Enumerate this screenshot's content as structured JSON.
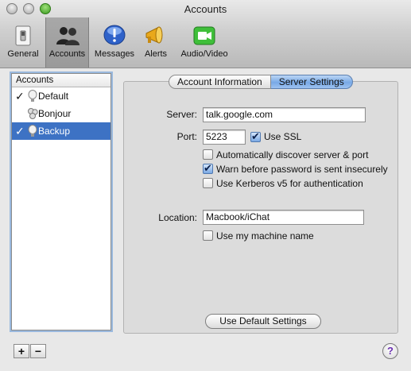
{
  "window": {
    "title": "Accounts"
  },
  "toolbar": {
    "items": [
      {
        "label": "General",
        "icon": "switch-icon"
      },
      {
        "label": "Accounts",
        "icon": "people-icon",
        "selected": true
      },
      {
        "label": "Messages",
        "icon": "exclamation-bubble-icon"
      },
      {
        "label": "Alerts",
        "icon": "megaphone-icon"
      },
      {
        "label": "Audio/Video",
        "icon": "video-camera-icon"
      }
    ]
  },
  "accounts": {
    "header": "Accounts",
    "items": [
      {
        "name": "Default",
        "checked": true,
        "check_mark": "✓",
        "icon": "lightbulb-icon"
      },
      {
        "name": "Bonjour",
        "checked": false,
        "check_mark": "",
        "icon": "bonjour-icon"
      },
      {
        "name": "Backup",
        "checked": true,
        "check_mark": "✓",
        "icon": "lightbulb-icon",
        "selected": true
      }
    ],
    "add_label": "+",
    "remove_label": "−"
  },
  "tabs": [
    {
      "label": "Account Information",
      "active": false
    },
    {
      "label": "Server Settings",
      "active": true
    }
  ],
  "server_settings": {
    "server_label": "Server:",
    "server_value": "talk.google.com",
    "port_label": "Port:",
    "port_value": "5223",
    "use_ssl_label": "Use SSL",
    "use_ssl_checked": true,
    "auto_discover_label": "Automatically discover server & port",
    "auto_discover_checked": false,
    "warn_password_label": "Warn before password is sent insecurely",
    "warn_password_checked": true,
    "kerberos_label": "Use Kerberos v5 for authentication",
    "kerberos_checked": false,
    "location_label": "Location:",
    "location_value": "Macbook/iChat",
    "machine_name_label": "Use my machine name",
    "machine_name_checked": false,
    "default_button_label": "Use Default Settings"
  },
  "help_label": "?",
  "colors": {
    "selection": "#3d72c4",
    "accent": "#78a9e6"
  }
}
